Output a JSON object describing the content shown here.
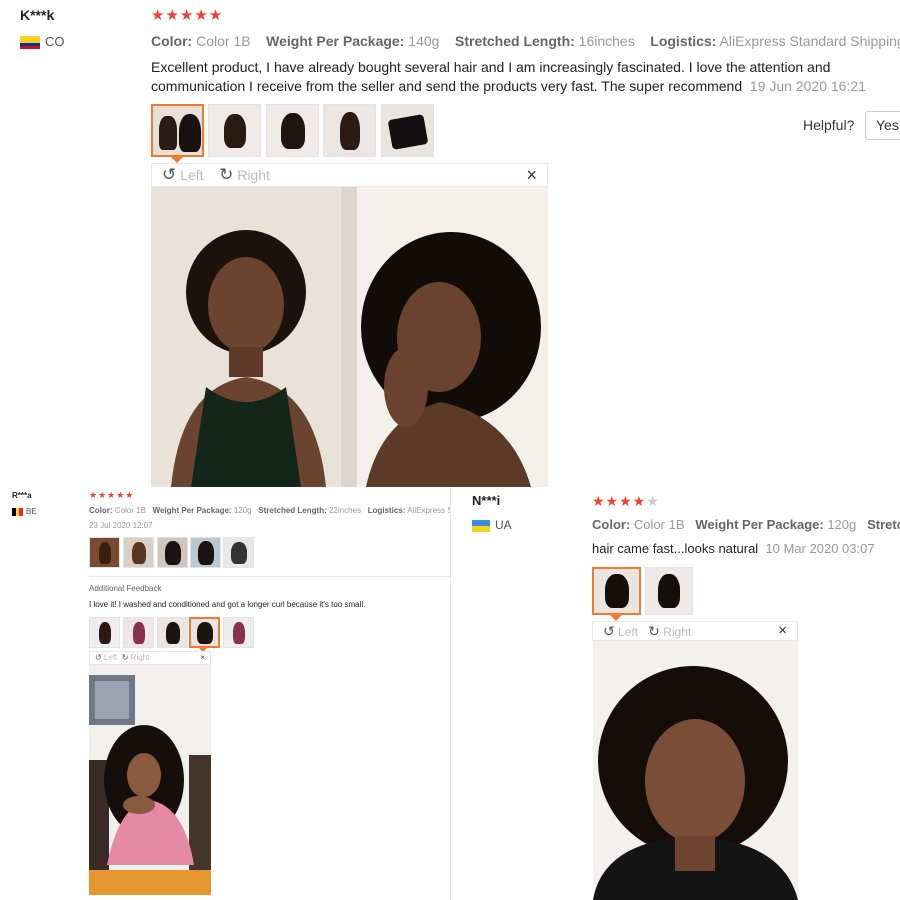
{
  "review1": {
    "name": "K***k",
    "country": "CO",
    "stars": "★★★★★",
    "attr_color_label": "Color:",
    "attr_color_value": "Color 1B",
    "attr_weight_label": "Weight Per Package:",
    "attr_weight_value": "140g",
    "attr_length_label": "Stretched Length:",
    "attr_length_value": "16inches",
    "attr_logistics_label": "Logistics:",
    "attr_logistics_value": "AliExpress Standard Shipping",
    "text_line1": "Excellent product, I have already bought several hair and I am increasingly fascinated. I love the attention and",
    "text_line2": "communication I receive from the seller and send the products very fast. The super recommend",
    "date": "19 Jun 2020 16:21",
    "helpful_label": "Helpful?",
    "yes_label": "Yes",
    "viewer_left": "Left",
    "viewer_right": "Right",
    "viewer_close": "×"
  },
  "review2": {
    "name": "R***a",
    "country": "BE",
    "stars": "★★★★★",
    "attr_color_label": "Color:",
    "attr_color_value": "Color 1B",
    "attr_weight_label": "Weight Per Package:",
    "attr_weight_value": "120g",
    "attr_length_label": "Stretched Length:",
    "attr_length_value": "22inches",
    "attr_logistics_label": "Logistics:",
    "attr_logistics_value": "AliExpress S",
    "date": "23 Jul 2020 12:07",
    "additional_label": "Additional Feedback",
    "additional_text": "I love it! I washed and conditioned and got a longer curl because it's too small.",
    "viewer_left": "Left",
    "viewer_right": "Right",
    "viewer_close": "×"
  },
  "review3": {
    "name": "N***i",
    "country": "UA",
    "stars_on": "★★★★",
    "stars_off": "★",
    "rating": 4,
    "attr_color_label": "Color:",
    "attr_color_value": "Color 1B",
    "attr_weight_label": "Weight Per Package:",
    "attr_weight_value": "120g",
    "attr_length_label": "Stretch",
    "text": "hair came fast...looks natural",
    "date": "10 Mar 2020 03:07",
    "viewer_left": "Left",
    "viewer_right": "Right",
    "viewer_close": "×"
  },
  "colors": {
    "star": "#f0422e",
    "active_border": "#f07b2e",
    "muted": "#999999"
  },
  "icons": {
    "rotate_left": "↺",
    "rotate_right": "↻"
  }
}
